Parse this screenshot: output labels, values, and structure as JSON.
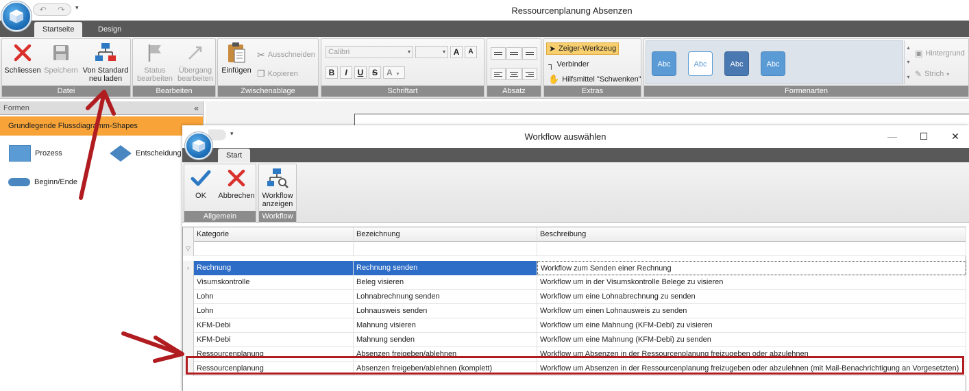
{
  "app": {
    "title": "Ressourcenplanung Absenzen",
    "tabs": [
      "Startseite",
      "Design"
    ],
    "qat_more": "▾"
  },
  "ribbon": {
    "datei": {
      "label": "Datei",
      "close": "Schliessen",
      "save": "Speichern",
      "reset_line1": "Von Standard",
      "reset_line2": "neu laden"
    },
    "bearbeiten": {
      "label": "Bearbeiten",
      "status_line1": "Status",
      "status_line2": "bearbeiten",
      "transition_line1": "Übergang",
      "transition_line2": "bearbeiten"
    },
    "zwischenablage": {
      "label": "Zwischenablage",
      "paste": "Einfügen",
      "cut": "Ausschneiden",
      "copy": "Kopieren"
    },
    "schriftart": {
      "label": "Schriftart",
      "font_value": "Calibri",
      "size_value": "",
      "grow": "A",
      "shrink": "A",
      "bold": "B",
      "italic": "I",
      "underline": "U",
      "strike": "S",
      "color": "A"
    },
    "absatz": {
      "label": "Absatz"
    },
    "extras": {
      "label": "Extras",
      "pointer": "Zeiger-Werkzeug",
      "connector": "Verbinder",
      "pan": "Hilfsmittel \"Schwenken\""
    },
    "formenarten": {
      "label": "Formenarten",
      "swatches": [
        {
          "text": "Abc",
          "bg": "#5b9bd5",
          "fg": "#ffffff",
          "border": "#4a87c0"
        },
        {
          "text": "Abc",
          "bg": "#ffffff",
          "fg": "#5b9bd5",
          "border": "#5b9bd5"
        },
        {
          "text": "Abc",
          "bg": "#4a78b0",
          "fg": "#ffffff",
          "border": "#3a6598"
        },
        {
          "text": "Abc",
          "bg": "#5b9bd5",
          "fg": "#ffffff",
          "border": "#4a87c0"
        }
      ],
      "background": "Hintergrund",
      "stroke": "Strich"
    }
  },
  "panel": {
    "title": "Formen",
    "collapse": "«",
    "category": "Grundlegende Flussdiagramm-Shapes",
    "shapes": [
      "Prozess",
      "Entscheidung",
      "Beginn/Ende"
    ]
  },
  "dialog": {
    "title": "Workflow auswählen",
    "tab": "Start",
    "minimize": "—",
    "maximize": "☐",
    "close": "✕",
    "allgemein": {
      "label": "Allgemein",
      "ok": "OK",
      "cancel": "Abbrechen"
    },
    "workflow": {
      "label": "Workflow",
      "show_line1": "Workflow",
      "show_line2": "anzeigen"
    }
  },
  "grid": {
    "columns": [
      "Kategorie",
      "Bezeichnung",
      "Beschreibung"
    ],
    "rows": [
      [
        "Rechnung",
        "Rechnung senden",
        "Workflow zum Senden einer Rechnung"
      ],
      [
        "Visumskontrolle",
        "Beleg visieren",
        "Workflow um in der Visumskontrolle Belege zu visieren"
      ],
      [
        "Lohn",
        "Lohnabrechnung senden",
        "Workflow um eine Lohnabrechnung zu senden"
      ],
      [
        "Lohn",
        "Lohnausweis senden",
        "Workflow um einen Lohnausweis zu senden"
      ],
      [
        "KFM-Debi",
        "Mahnung visieren",
        "Workflow um eine Mahnung (KFM-Debi) zu visieren"
      ],
      [
        "KFM-Debi",
        "Mahnung senden",
        "Workflow um eine Mahnung (KFM-Debi) zu senden"
      ],
      [
        "Ressourcenplanung",
        "Absenzen freigeben/ablehnen",
        "Workflow um Absenzen in der Ressourcenplanung freizugeben oder abzulehnen"
      ],
      [
        "Ressourcenplanung",
        "Absenzen freigeben/ablehnen (komplett)",
        "Workflow um Absenzen in der Ressourcenplanung freizugeben oder abzulehnen (mit Mail-Benachrichtigung an Vorgesetzten)"
      ]
    ],
    "selected_row": 0,
    "highlighted_row": 7
  },
  "colors": {
    "accent_red": "#d9302c",
    "accent_blue": "#2d6cc7",
    "annotation_red": "#b01c20",
    "category_orange": "#f7a337"
  }
}
